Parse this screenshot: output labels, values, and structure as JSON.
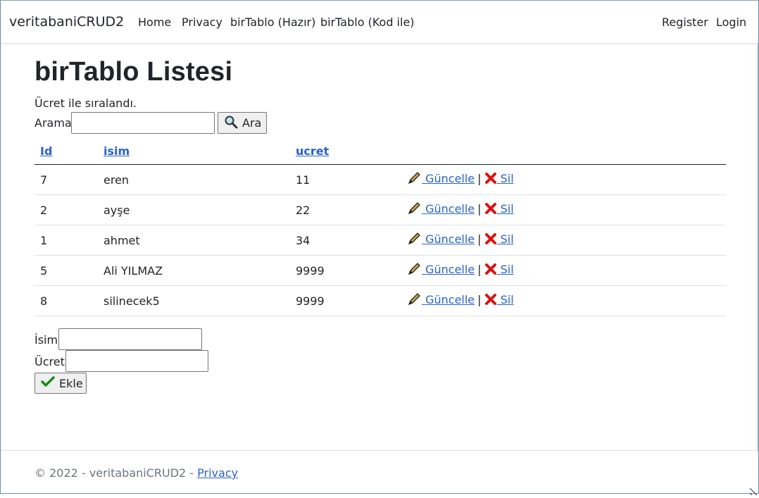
{
  "navbar": {
    "brand": "veritabaniCRUD2",
    "links": [
      "Home",
      "Privacy",
      "birTablo (Hazır)",
      "birTablo (Kod ile)"
    ],
    "right_links": [
      "Register",
      "Login"
    ]
  },
  "page": {
    "title": "birTablo Listesi",
    "sorted_text": "Ücret ile sıralandı.",
    "search_label": "Arama",
    "search_value": "",
    "search_button": "Ara"
  },
  "table": {
    "headers": [
      "Id",
      "isim",
      "ucret"
    ],
    "rows": [
      {
        "id": "7",
        "isim": "eren",
        "ucret": "11"
      },
      {
        "id": "2",
        "isim": "ayşe",
        "ucret": "22"
      },
      {
        "id": "1",
        "isim": "ahmet",
        "ucret": "34"
      },
      {
        "id": "5",
        "isim": "Ali YILMAZ",
        "ucret": "9999"
      },
      {
        "id": "8",
        "isim": "silinecek5",
        "ucret": "9999"
      }
    ],
    "update_label": " Güncelle",
    "separator": "|",
    "delete_label": " Sil"
  },
  "form": {
    "isim_label": "İsim",
    "isim_value": "",
    "ucret_label": "Ücret",
    "ucret_value": "",
    "add_button": "Ekle"
  },
  "footer": {
    "text": "© 2022 - veritabaniCRUD2 - ",
    "link": "Privacy"
  },
  "colors": {
    "link": "#2a63c9",
    "check": "#1a8a1a",
    "delete": "#d11"
  },
  "icons": [
    "search-icon",
    "pencil-icon",
    "delete-x-icon",
    "check-icon"
  ]
}
